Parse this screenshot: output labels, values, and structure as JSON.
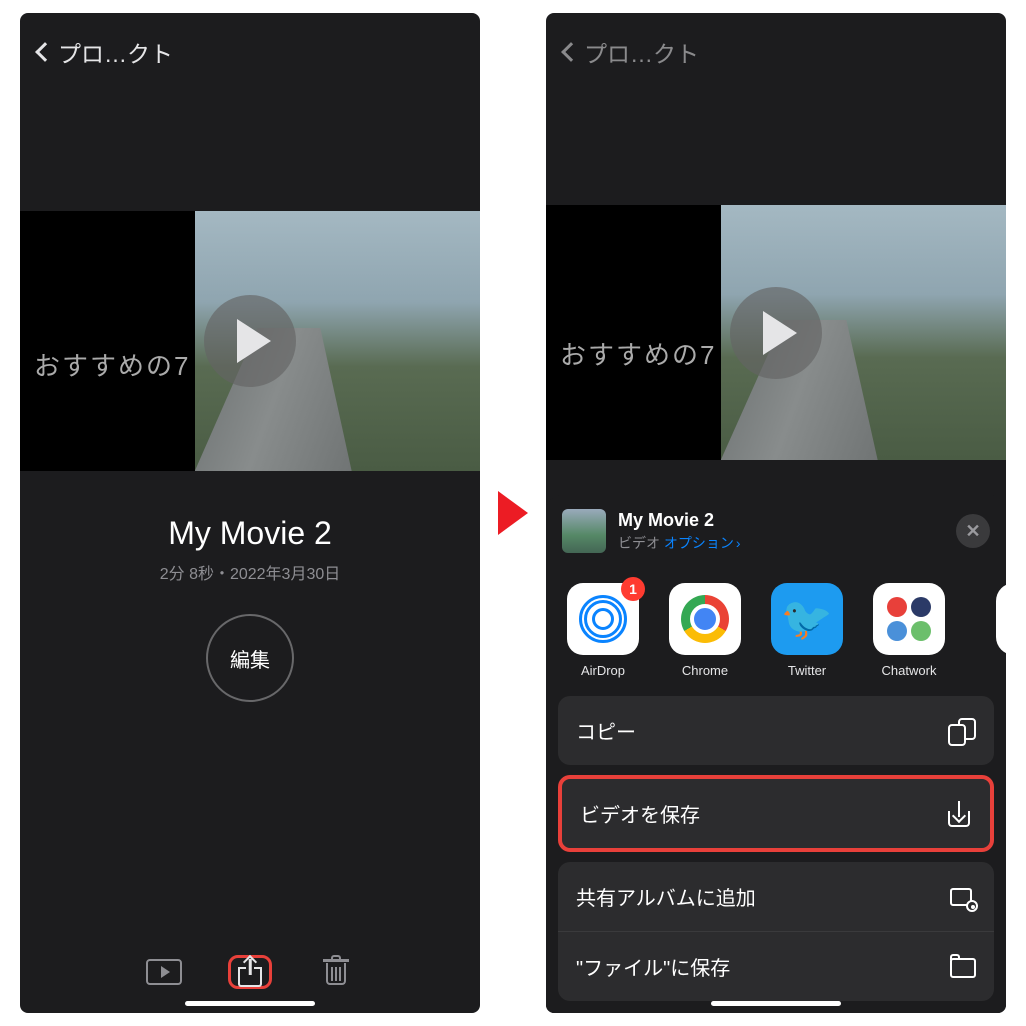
{
  "left": {
    "back_label": "プロ…クト",
    "preview_text": "おすすめの7",
    "title": "My Movie 2",
    "subtitle": "2分 8秒・2022年3月30日",
    "edit_label": "編集"
  },
  "right": {
    "back_label": "プロ…クト",
    "preview_text": "おすすめの7",
    "sheet": {
      "title": "My Movie 2",
      "subtitle_type": "ビデオ",
      "subtitle_options": "オプション",
      "airdrop_badge": "1",
      "apps": [
        {
          "label": "AirDrop"
        },
        {
          "label": "Chrome"
        },
        {
          "label": "Twitter"
        },
        {
          "label": "Chatwork"
        }
      ],
      "actions": {
        "copy": "コピー",
        "save_video": "ビデオを保存",
        "add_album": "共有アルバムに追加",
        "save_files": "\"ファイル\"に保存"
      }
    }
  }
}
